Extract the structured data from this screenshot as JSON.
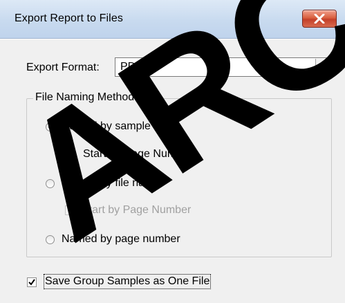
{
  "window": {
    "title": "Export Report to Files",
    "close_icon": "close-icon"
  },
  "export_format": {
    "label": "Export Format:",
    "selected": "PDF file"
  },
  "file_naming": {
    "label": "File Naming Method",
    "options": [
      {
        "label": "Named by sample name",
        "selected": true,
        "sub_option": {
          "label": "Start by Page Number",
          "checked": false,
          "enabled": true
        }
      },
      {
        "label": "Named by file name",
        "selected": false,
        "sub_option": {
          "label": "Start by Page Number",
          "checked": false,
          "enabled": false
        }
      },
      {
        "label": "Named by page number",
        "selected": false
      }
    ]
  },
  "save_group": {
    "label": "Save Group Samples as One File",
    "checked": true
  },
  "watermark": {
    "text": "ARCI",
    "color": "#000000"
  }
}
